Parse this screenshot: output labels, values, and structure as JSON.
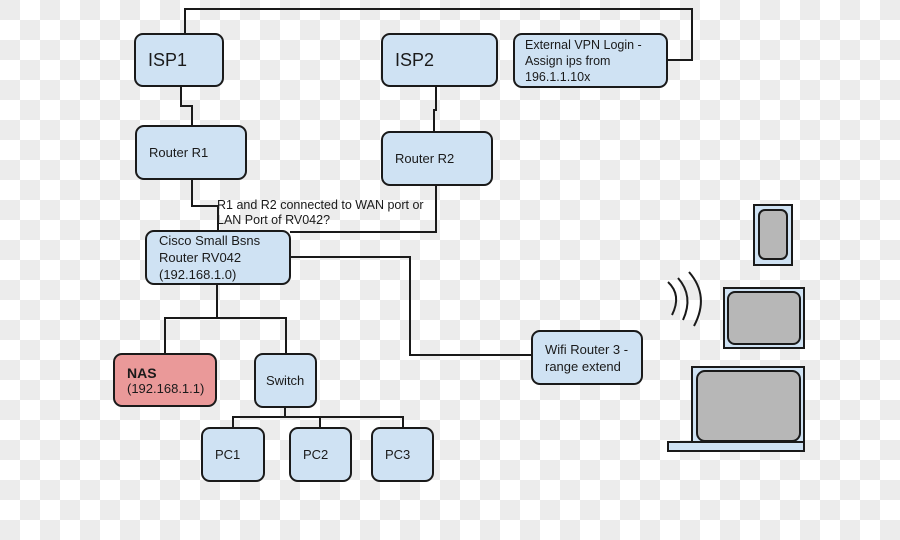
{
  "diagram": {
    "title": "",
    "nodes": {
      "isp1": {
        "label": "ISP1"
      },
      "isp2": {
        "label": "ISP2"
      },
      "vpn": {
        "label": "External VPN Login -\nAssign ips from\n196.1.1.10x"
      },
      "router_r1": {
        "label": "Router R1"
      },
      "router_r2": {
        "label": "Router R2"
      },
      "rv042": {
        "label": "Cisco Small Bsns\nRouter RV042\n(192.168.1.0)"
      },
      "nas": {
        "title": "NAS",
        "ip": "(192.168.1.1)",
        "color": "#ea9999"
      },
      "switch": {
        "label": "Switch"
      },
      "pc1": {
        "label": "PC1"
      },
      "pc2": {
        "label": "PC2"
      },
      "pc3": {
        "label": "PC3"
      },
      "wifi_router3": {
        "label": "Wifi Router 3 -\nrange extend"
      }
    },
    "annotation": "R1 and R2 connected to WAN port or\nLAN Port of RV042?",
    "devices": [
      "wireless-signal-icon",
      "phone-icon",
      "tablet-icon",
      "laptop-icon"
    ],
    "edges": [
      [
        "isp1",
        "vpn"
      ],
      [
        "isp1",
        "router_r1"
      ],
      [
        "isp2",
        "router_r2"
      ],
      [
        "router_r1",
        "rv042"
      ],
      [
        "router_r2",
        "rv042"
      ],
      [
        "rv042",
        "nas"
      ],
      [
        "rv042",
        "switch"
      ],
      [
        "rv042",
        "wifi_router3"
      ],
      [
        "switch",
        "pc1"
      ],
      [
        "switch",
        "pc2"
      ],
      [
        "switch",
        "pc3"
      ]
    ],
    "colors": {
      "node_fill": "#cfe2f3",
      "nas_fill": "#ea9999",
      "stroke": "#1a1a1a",
      "screen": "#b7b7b7"
    }
  }
}
